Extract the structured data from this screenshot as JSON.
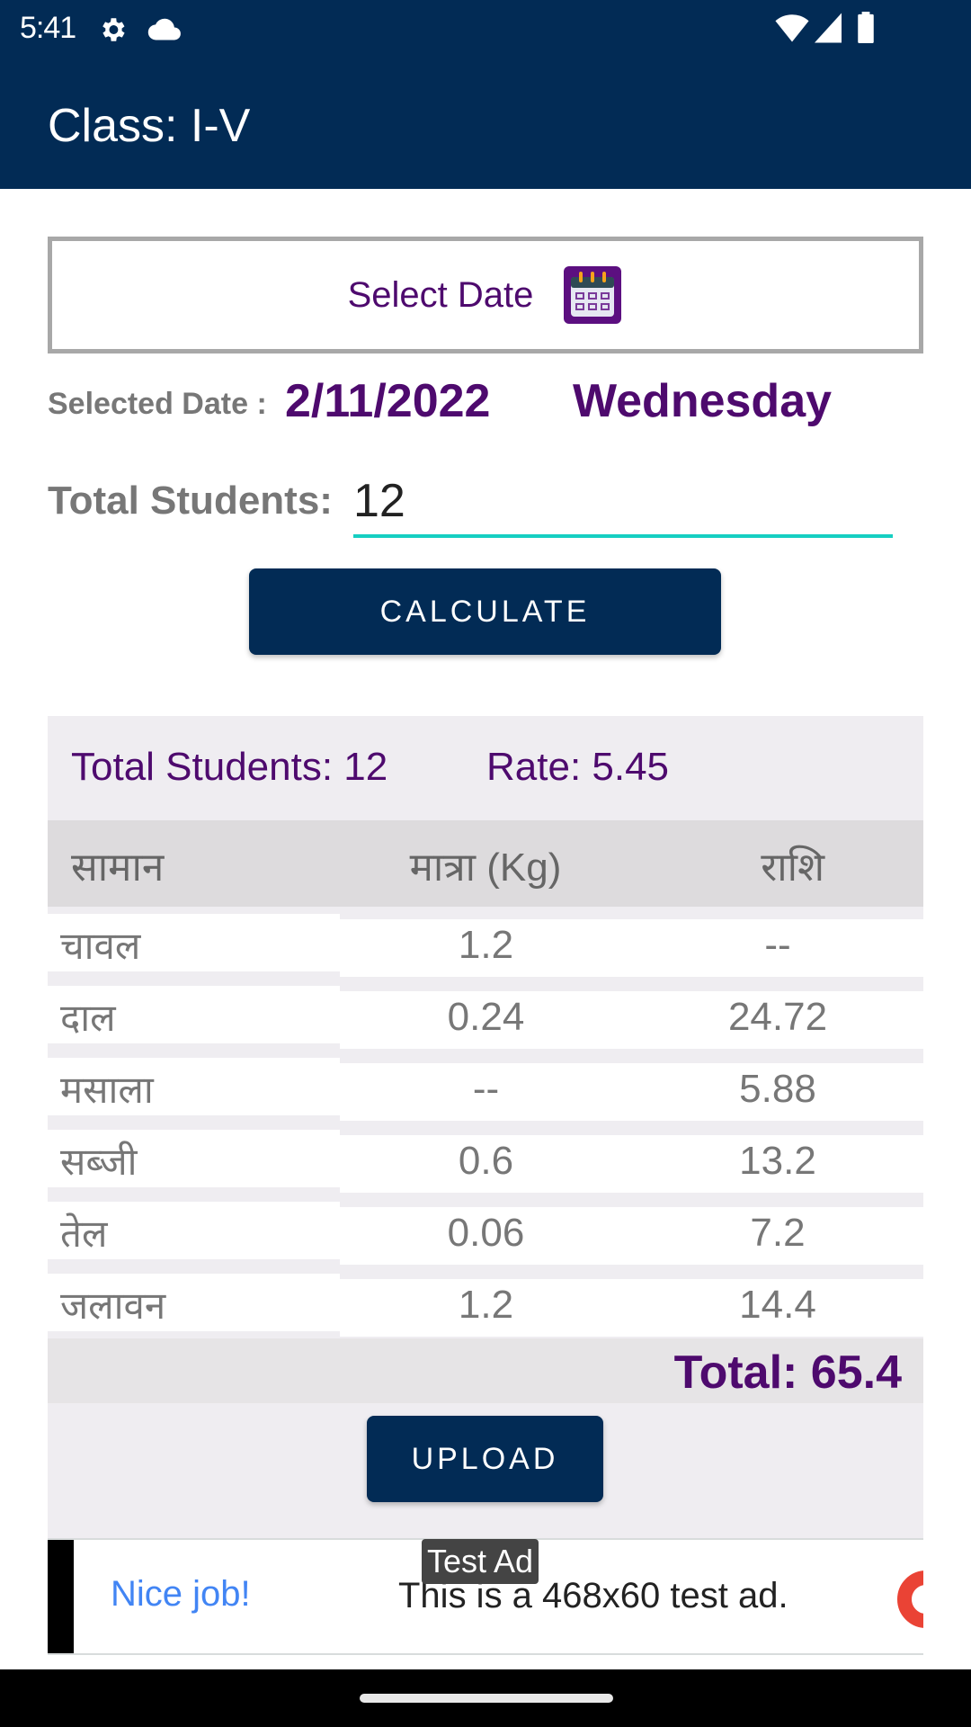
{
  "status_bar": {
    "time": "5:41",
    "icons": [
      "gear-icon",
      "cloud-icon",
      "wifi-icon",
      "signal-icon",
      "battery-icon"
    ]
  },
  "app_bar": {
    "title": "Class: I-V"
  },
  "date_picker": {
    "label": "Select Date",
    "icon": "calendar-icon"
  },
  "selected_date": {
    "label": "Selected Date :",
    "date": "2/11/2022",
    "weekday": "Wednesday"
  },
  "students_input": {
    "label": "Total Students:",
    "value": "12"
  },
  "calculate_button": {
    "label": "CALCULATE"
  },
  "result": {
    "summary": "Total Students: 12",
    "rate": "Rate: 5.45",
    "columns": [
      "सामान",
      "मात्रा (Kg)",
      "राशि"
    ],
    "rows": [
      {
        "item": "चावल",
        "qty": "1.2",
        "amount": "--"
      },
      {
        "item": "दाल",
        "qty": "0.24",
        "amount": "24.72"
      },
      {
        "item": "मसाला",
        "qty": "--",
        "amount": "5.88"
      },
      {
        "item": "सब्जी",
        "qty": "0.6",
        "amount": "13.2"
      },
      {
        "item": "तेल",
        "qty": "0.06",
        "amount": "7.2"
      },
      {
        "item": "जलावन",
        "qty": "1.2",
        "amount": "14.4"
      }
    ],
    "total": "Total: 65.4",
    "upload_label": "UPLOAD"
  },
  "ad": {
    "badge": "Test Ad",
    "headline": "Nice job!",
    "text": "This is a 468x60 test ad."
  },
  "colors": {
    "primary": "#022b55",
    "accent_purple": "#4e0a6e",
    "input_underline": "#16cfc2"
  }
}
